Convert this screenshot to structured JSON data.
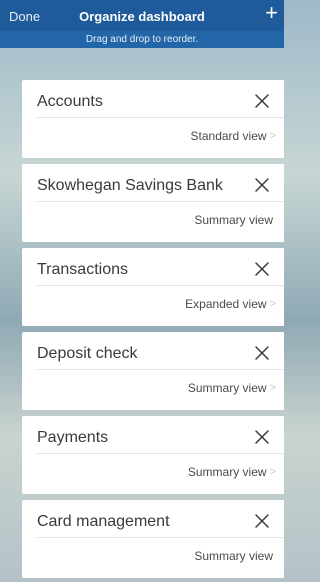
{
  "header": {
    "done_label": "Done",
    "title": "Organize dashboard",
    "add_icon": "plus-icon",
    "subtitle": "Drag and drop to reorder."
  },
  "cards": [
    {
      "title": "Accounts",
      "view": "Standard view",
      "chevron": ">"
    },
    {
      "title": "Skowhegan Savings Bank",
      "view": "Summary view",
      "chevron": ""
    },
    {
      "title": "Transactions",
      "view": "Expanded view",
      "chevron": ">"
    },
    {
      "title": "Deposit check",
      "view": "Summary view",
      "chevron": ">"
    },
    {
      "title": "Payments",
      "view": "Summary view",
      "chevron": ">"
    },
    {
      "title": "Card management",
      "view": "Summary view",
      "chevron": ""
    }
  ],
  "colors": {
    "header_bg": "#1f5b9b",
    "subbar_bg": "#2366a8",
    "card_bg": "#ffffff"
  }
}
